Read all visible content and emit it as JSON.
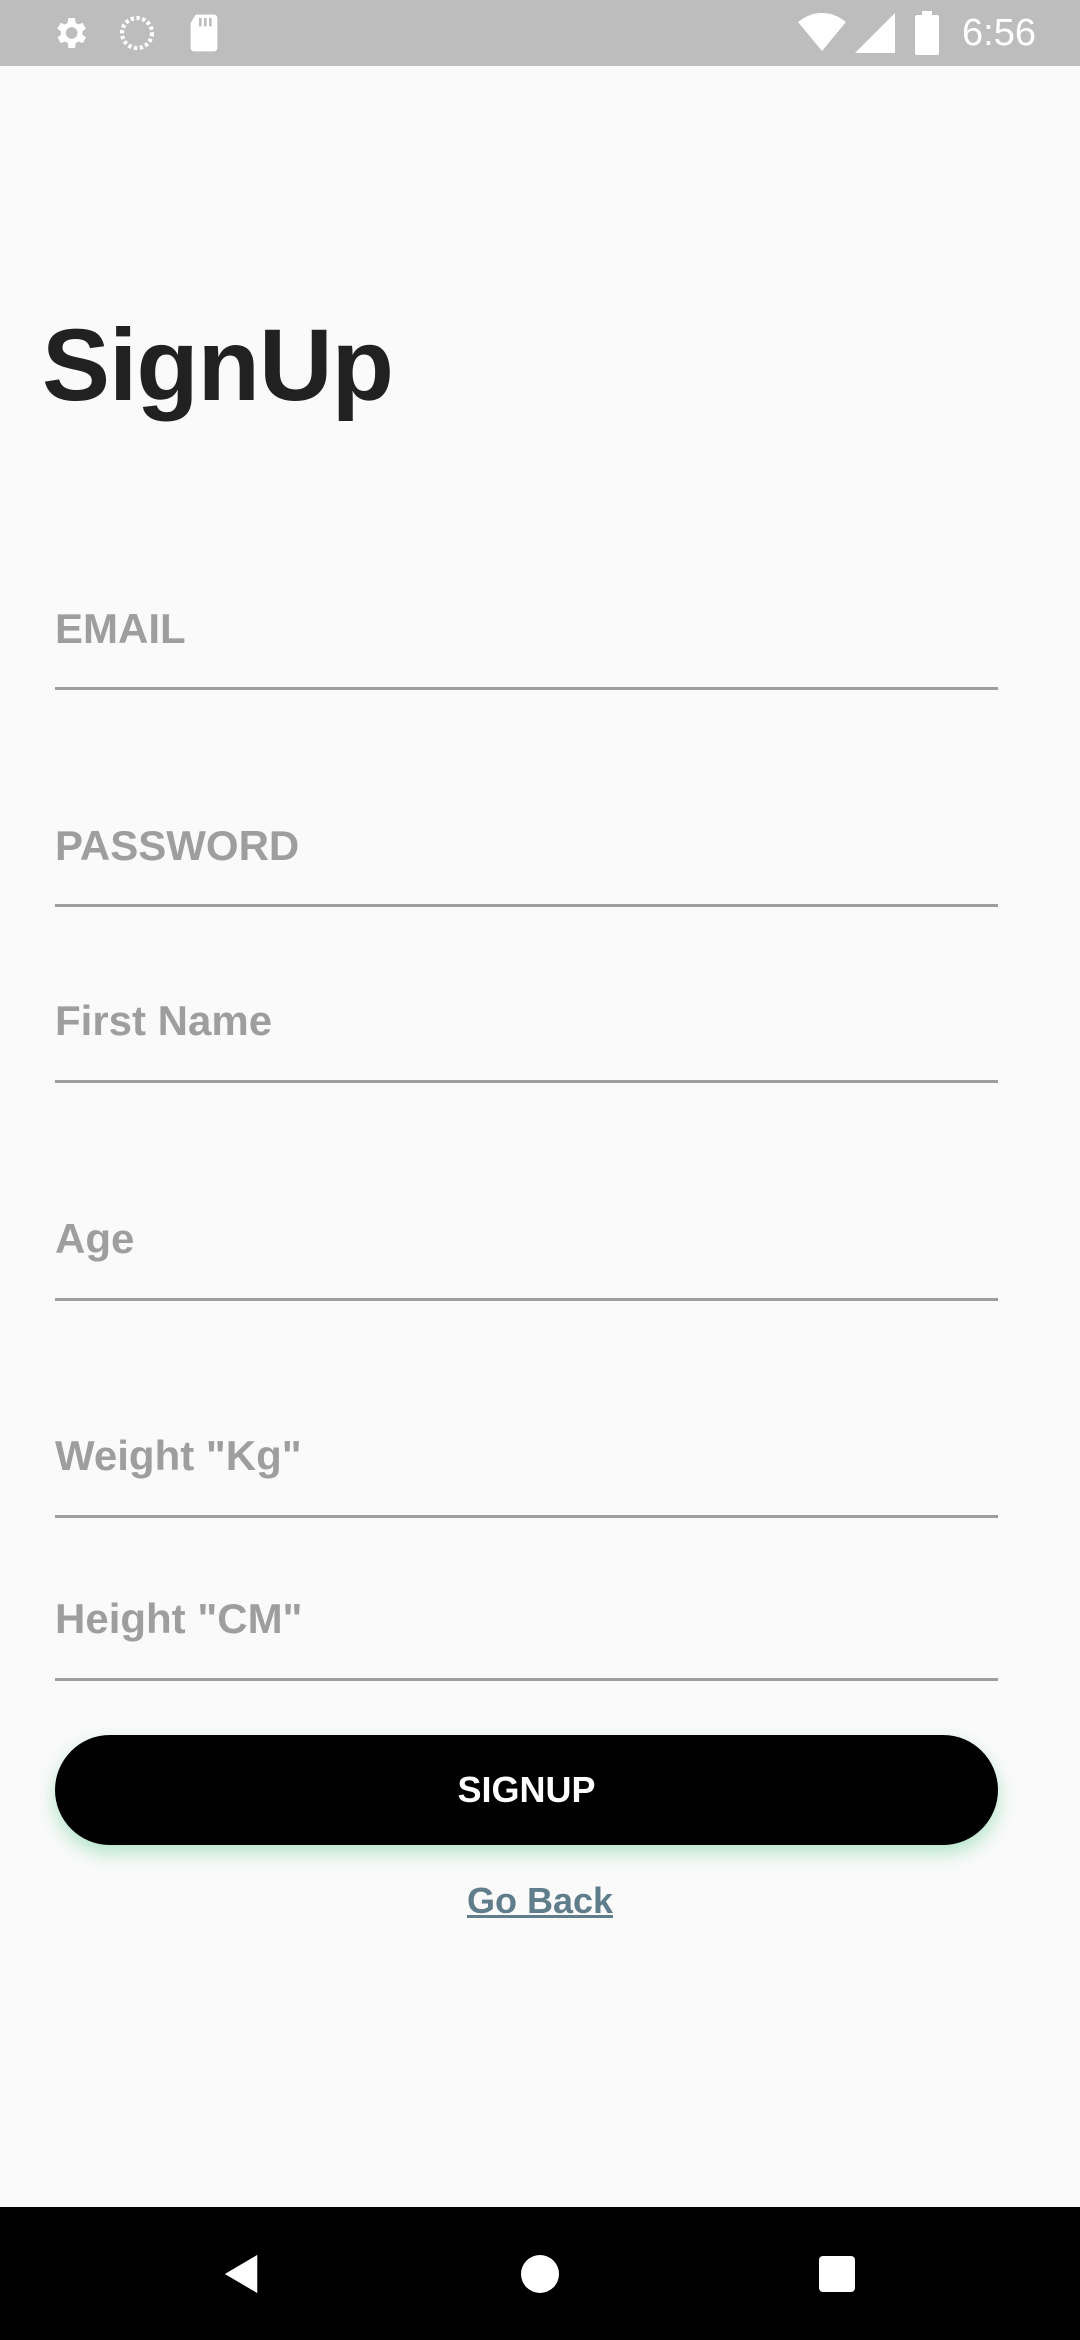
{
  "status_bar": {
    "time": "6:56",
    "icons": [
      "gear-icon",
      "sync-icon",
      "sd-card-icon",
      "wifi-icon",
      "signal-icon",
      "battery-icon"
    ]
  },
  "page": {
    "title": "SignUp"
  },
  "form": {
    "email_placeholder": "EMAIL",
    "password_placeholder": "PASSWORD",
    "first_name_placeholder": "First Name",
    "age_placeholder": "Age",
    "weight_placeholder": "Weight \"Kg\"",
    "height_placeholder": "Height \"CM\"",
    "signup_label": "SIGNUP",
    "go_back_label": "Go Back"
  },
  "nav_bar": {
    "icons": [
      "back-icon",
      "home-icon",
      "recents-icon"
    ]
  },
  "colors": {
    "background": "#fafafa",
    "status_bar": "#bdbdbd",
    "title": "#212121",
    "placeholder": "#9e9e9e",
    "button": "#000000",
    "button_shadow": "#78d2a0",
    "link": "#607d8b"
  }
}
